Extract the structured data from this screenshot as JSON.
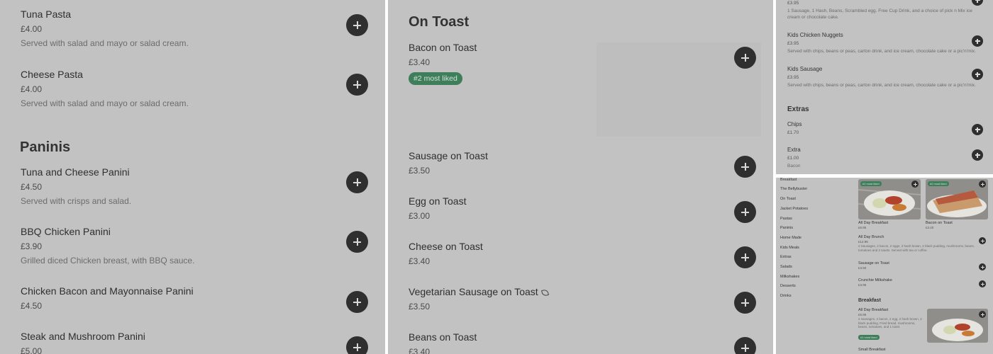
{
  "panel1": {
    "items_top": [
      {
        "name": "Tuna Pasta",
        "price": "£4.00",
        "desc": "Served with salad and mayo or salad cream."
      },
      {
        "name": "Cheese Pasta",
        "price": "£4.00",
        "desc": "Served with salad and mayo or salad cream."
      }
    ],
    "section": "Paninis",
    "items": [
      {
        "name": "Tuna and Cheese Panini",
        "price": "£4.50",
        "desc": "Served with crisps and salad."
      },
      {
        "name": "BBQ Chicken Panini",
        "price": "£3.90",
        "desc": "Grilled diced Chicken breast, with BBQ sauce."
      },
      {
        "name": "Chicken Bacon and Mayonnaise Panini",
        "price": "£4.50",
        "desc": ""
      },
      {
        "name": "Steak and Mushroom Panini",
        "price": "£5.00",
        "desc": ""
      }
    ]
  },
  "panel2": {
    "section": "On Toast",
    "featured": {
      "name": "Bacon on Toast",
      "price": "£3.40",
      "badge": "#2 most liked"
    },
    "items": [
      {
        "name": "Sausage on Toast",
        "price": "£3.50"
      },
      {
        "name": "Egg on Toast",
        "price": "£3.00"
      },
      {
        "name": "Cheese on Toast",
        "price": "£3.40"
      },
      {
        "name": "Vegetarian Sausage on Toast",
        "price": "£3.50",
        "icon": "leaf-icon"
      },
      {
        "name": "Beans on Toast",
        "price": "£3.40"
      }
    ]
  },
  "panel3": {
    "top_price": "£3.95",
    "top_desc_1": "1 Sausage, 1 Hash, Beans, Scrambled egg. Free Cup Drink, and a choice of pick n Mix ice",
    "top_desc_2": "cream or chocolate cake.",
    "items": [
      {
        "name": "Kids Chicken Nuggets",
        "price": "£3.95",
        "desc": "Served with chips, beans or peas, carton drink, and ice cream, chocolate cake or a pic'n'mix."
      },
      {
        "name": "Kids Sausage",
        "price": "£3.95",
        "desc": "Served with chips, beans or peas, carton drink, and ice cream, chocolate cake or a pic'n'mix."
      }
    ],
    "section": "Extras",
    "extras": [
      {
        "name": "Chips",
        "price": "£1.70",
        "desc": ""
      },
      {
        "name": "Extra",
        "price": "£1.00",
        "desc": "Bacon"
      }
    ]
  },
  "panel4": {
    "nav": [
      "Breakfast",
      "The Bellybuster",
      "On Toast",
      "Jacket Potatoes",
      "Pastas",
      "Paninis",
      "Home Made",
      "Kids Meals",
      "Extras",
      "Salads",
      "Milkshakes",
      "Desserts",
      "Drinks"
    ],
    "featured": [
      {
        "name": "All Day Breakfast",
        "price": "£6.95",
        "badge": "#1 most liked"
      },
      {
        "name": "Bacon on Toast",
        "price": "£3.40",
        "badge": "#2 most liked"
      }
    ],
    "list": [
      {
        "name": "All Day Brunch",
        "price": "£12.95",
        "desc": "2 Sausages, 2 bacon, 2 eggs, 2 hash brown, 2 black pudding, mushrooms, beans, tomatoes and 2 toasts. Served with tea or coffee."
      },
      {
        "name": "Sausage on Toast",
        "price": "£3.50",
        "desc": ""
      },
      {
        "name": "Crunchie Milkshake",
        "price": "£3.95",
        "desc": ""
      }
    ],
    "section": "Breakfast",
    "breakfast": {
      "name": "All Day Breakfast",
      "price": "£6.95",
      "desc": "2 sausages, 2 bacon, 2 egg, 2 hash brown, 2 black pudding, Fried bread, mushrooms, beans, tomatoes, and 1 toast.",
      "badge": "#1 most liked"
    },
    "next": "Small Breakfast"
  }
}
